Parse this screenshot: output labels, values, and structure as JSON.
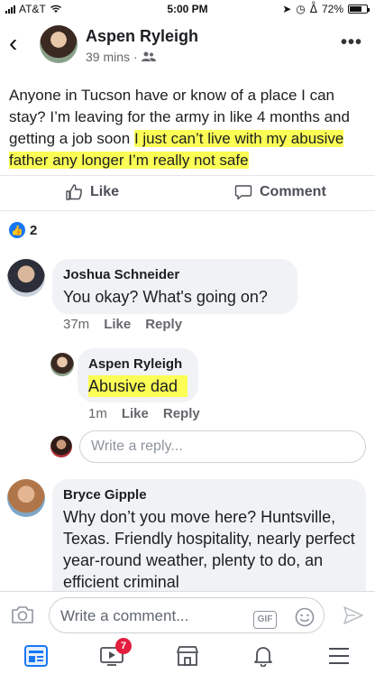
{
  "status_bar": {
    "carrier": "AT&T",
    "time": "5:00 PM",
    "battery": "72%",
    "battery_level": 0.72
  },
  "post": {
    "author": "Aspen Ryleigh",
    "time": "39 mins",
    "meta_separator": "·",
    "text_plain": "Anyone in Tucson have or know of a place I can stay? I’m leaving for the army in like 4 months and getting a job soon ",
    "text_highlight": "I just can’t live with my abusive father any longer I’m really not safe",
    "like_label": "Like",
    "comment_label": "Comment",
    "reaction_count": "2"
  },
  "comments": [
    {
      "author": "Joshua Schneider",
      "text": "You okay? What's going on?",
      "time": "37m",
      "like": "Like",
      "reply": "Reply"
    },
    {
      "author": "Aspen Ryleigh",
      "text": "Abusive dad",
      "time": "1m",
      "like": "Like",
      "reply": "Reply"
    },
    {
      "author": "Bryce Gipple",
      "text": "Why don’t you move here? Huntsville, Texas. Friendly hospitality, nearly perfect year-round weather, plenty to do, an efficient criminal"
    }
  ],
  "reply_placeholder": "Write a reply...",
  "composer": {
    "placeholder": "Write a comment...",
    "gif": "GIF"
  },
  "tabbar": {
    "video_badge": "7"
  },
  "icons": [
    "back-icon",
    "more-icon",
    "friends-icon",
    "thumbs-up-icon",
    "comment-icon",
    "camera-icon",
    "emoji-icon",
    "send-icon",
    "news-feed-icon",
    "watch-icon",
    "marketplace-icon",
    "bell-icon",
    "menu-icon"
  ],
  "colors": {
    "accent": "#1877f2",
    "highlight": "#fbff55",
    "badge": "#e41e3f"
  }
}
